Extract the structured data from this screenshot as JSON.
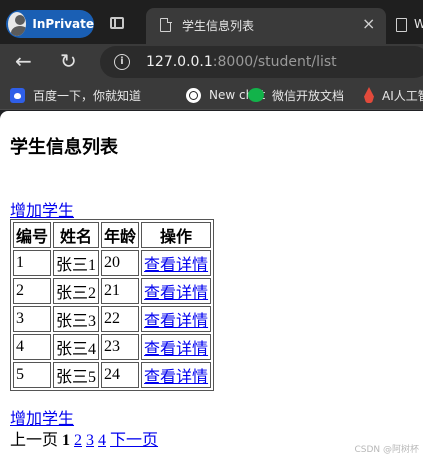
{
  "browser": {
    "inprivate_label": "InPrivate",
    "tab_title": "学生信息列表",
    "tab_close": "×",
    "tab2_title": "W",
    "url_host": "127.0.0.1",
    "url_rest": ":8000/student/list",
    "nav_back": "←",
    "nav_reload": "↻",
    "info_icon": "i"
  },
  "bookmarks": [
    {
      "label": "百度一下，你就知道",
      "icon": "baidu-icon"
    },
    {
      "label": "New chat",
      "icon": "chat-icon"
    },
    {
      "label": "微信开放文档",
      "icon": "wechat-icon"
    },
    {
      "label": "AI人工智",
      "icon": "ai-icon"
    }
  ],
  "page": {
    "title": "学生信息列表",
    "add_link": "增加学生",
    "table": {
      "headers": [
        "编号",
        "姓名",
        "年龄",
        "操作"
      ],
      "rows": [
        {
          "id": "1",
          "name": "张三1",
          "age": "20",
          "action": "查看详情"
        },
        {
          "id": "2",
          "name": "张三2",
          "age": "21",
          "action": "查看详情"
        },
        {
          "id": "3",
          "name": "张三3",
          "age": "22",
          "action": "查看详情"
        },
        {
          "id": "4",
          "name": "张三4",
          "age": "23",
          "action": "查看详情"
        },
        {
          "id": "5",
          "name": "张三5",
          "age": "24",
          "action": "查看详情"
        }
      ]
    },
    "pager": {
      "prev": "上一页",
      "current": "1",
      "pages": [
        "2",
        "3",
        "4"
      ],
      "next": "下一页"
    }
  },
  "watermark": "CSDN @阿树杯",
  "colors": {
    "link": "#0000ee",
    "inprivate_badge": "#1a5fb4",
    "chrome_dark": "#1f1f1f",
    "chrome_toolbar": "#3a3a3a"
  }
}
